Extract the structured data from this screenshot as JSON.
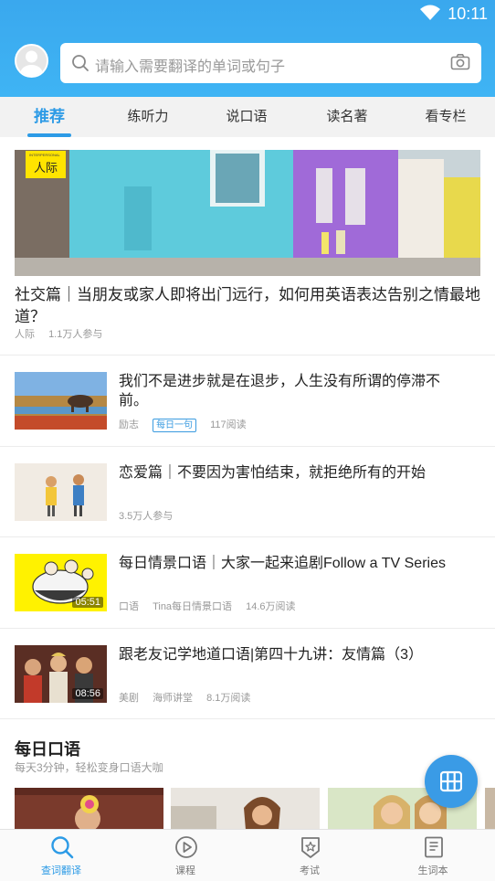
{
  "status_bar": {
    "time": "10:11"
  },
  "search": {
    "placeholder": "请输入需要翻译的单词或句子"
  },
  "tabs": [
    {
      "label": "推荐",
      "active": true
    },
    {
      "label": "练听力",
      "active": false
    },
    {
      "label": "说口语",
      "active": false
    },
    {
      "label": "读名著",
      "active": false
    },
    {
      "label": "看专栏",
      "active": false
    }
  ],
  "hero": {
    "badge_small": "INTERPERSONAL",
    "badge": "人际",
    "title": "社交篇｜当朋友或家人即将出门远行，如何用英语表达告别之情最地道？",
    "category": "人际",
    "participants": "1.1万人参与"
  },
  "feed": [
    {
      "title": "我们不是进步就是在退步，人生没有所谓的停滞不前。",
      "category": "励志",
      "tag": "每日一句",
      "reads": "117阅读"
    },
    {
      "title": "恋爱篇｜不要因为害怕结束，就拒绝所有的开始",
      "participants": "3.5万人参与"
    },
    {
      "title": "每日情景口语｜大家一起来追剧Follow a TV Series",
      "category": "口语",
      "author": "Tina每日情景口语",
      "reads": "14.6万阅读",
      "duration": "05:51"
    },
    {
      "title": "跟老友记学地道口语|第四十九讲：友情篇（3）",
      "category": "美剧",
      "author": "海师讲堂",
      "reads": "8.1万阅读",
      "duration": "08:56"
    }
  ],
  "daily": {
    "title": "每日口语",
    "subtitle": "每天3分钟，轻松变身口语大咖"
  },
  "bottom_nav": [
    {
      "label": "查词翻译",
      "icon": "search-icon",
      "active": true
    },
    {
      "label": "课程",
      "icon": "play-circle-icon",
      "active": false
    },
    {
      "label": "考试",
      "icon": "exam-badge-icon",
      "active": false
    },
    {
      "label": "生词本",
      "icon": "notebook-icon",
      "active": false
    }
  ],
  "colors": {
    "accent": "#2d9be6",
    "header": "#3aa8ee",
    "badge": "#ffe400"
  }
}
